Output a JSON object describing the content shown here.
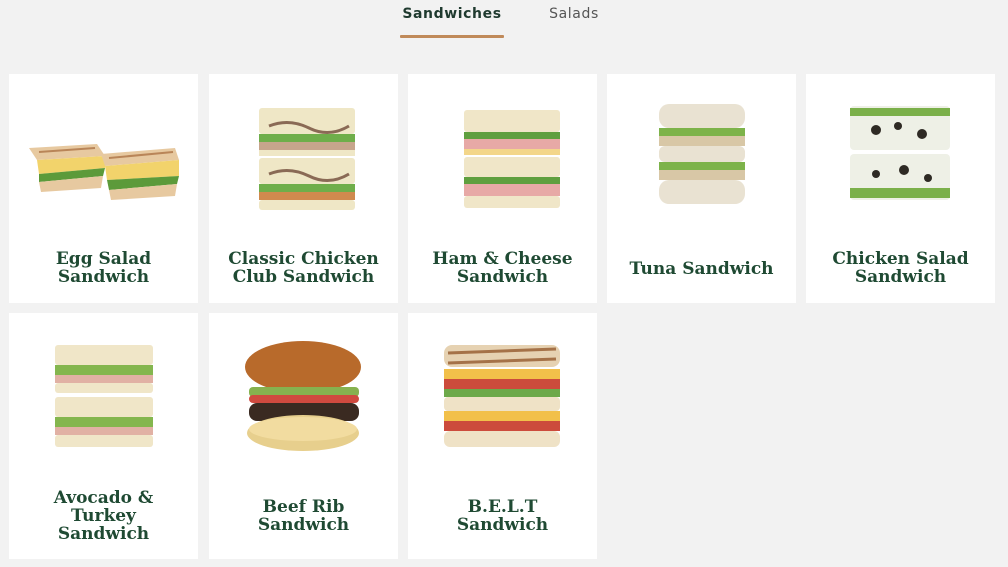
{
  "tabs": [
    {
      "label": "Sandwiches",
      "active": true
    },
    {
      "label": "Salads",
      "active": false
    }
  ],
  "items": [
    {
      "name": "Egg Salad\nSandwich",
      "icon": "egg-salad-sandwich-image"
    },
    {
      "name": "Classic Chicken\nClub Sandwich",
      "icon": "classic-chicken-club-sandwich-image"
    },
    {
      "name": "Ham & Cheese\nSandwich",
      "icon": "ham-cheese-sandwich-image"
    },
    {
      "name": "Tuna Sandwich",
      "icon": "tuna-sandwich-image"
    },
    {
      "name": "Chicken Salad\nSandwich",
      "icon": "chicken-salad-sandwich-image"
    },
    {
      "name": "Avocado &\nTurkey\nSandwich",
      "icon": "avocado-turkey-sandwich-image"
    },
    {
      "name": "Beef Rib\nSandwich",
      "icon": "beef-rib-sandwich-image"
    },
    {
      "name": "B.E.L.T\nSandwich",
      "icon": "belt-sandwich-image"
    }
  ],
  "colors": {
    "background": "#f2f2f2",
    "card": "#ffffff",
    "title_text": "#1f4a33",
    "tab_active_underline": "#c08a5a"
  }
}
